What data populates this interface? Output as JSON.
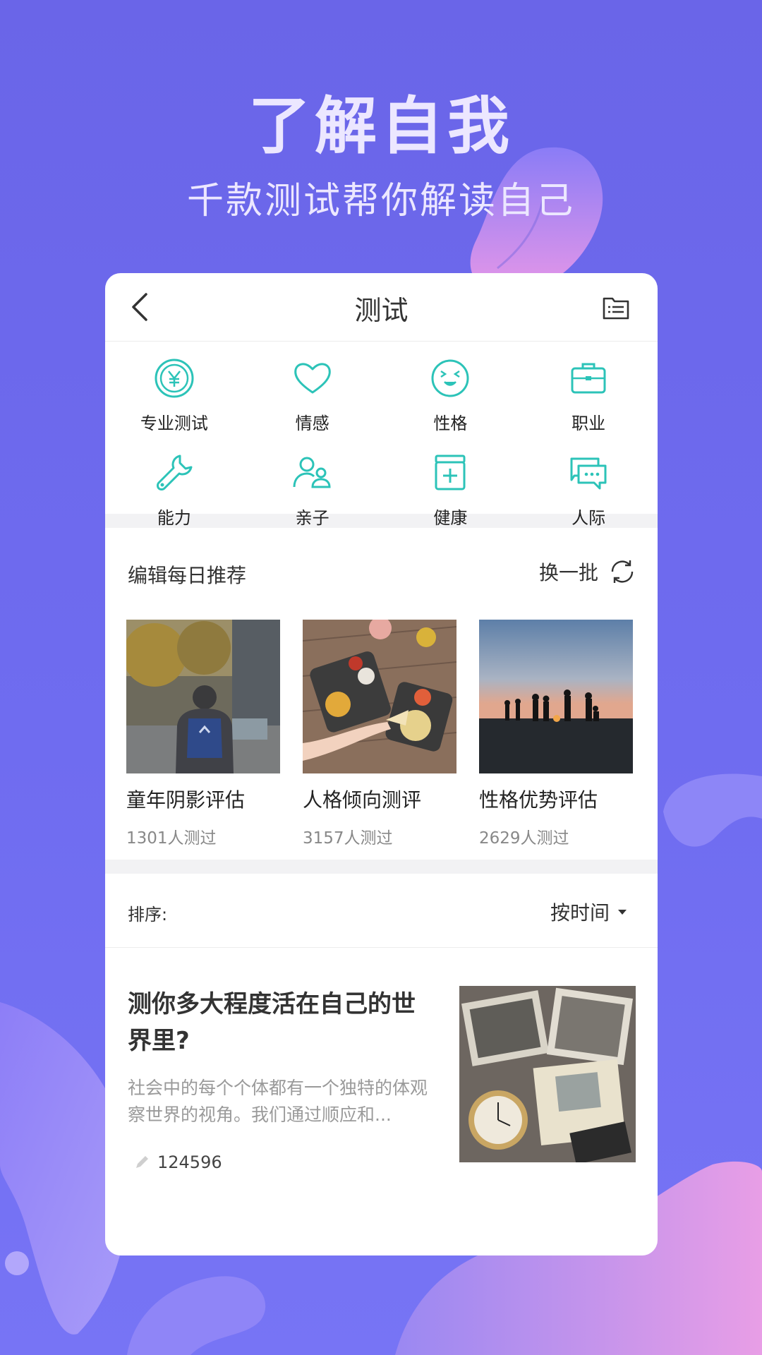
{
  "hero": {
    "title": "了解自我",
    "subtitle": "千款测试帮你解读自己"
  },
  "nav": {
    "title": "测试",
    "back_icon": "chevron-left-icon",
    "right_icon": "list-icon"
  },
  "accent_color": "#2cc3b8",
  "categories": [
    {
      "label": "专业测试",
      "icon": "yen-coin-icon"
    },
    {
      "label": "情感",
      "icon": "heart-icon"
    },
    {
      "label": "性格",
      "icon": "smiley-icon"
    },
    {
      "label": "职业",
      "icon": "briefcase-icon"
    },
    {
      "label": "能力",
      "icon": "wrench-icon"
    },
    {
      "label": "亲子",
      "icon": "parent-child-icon"
    },
    {
      "label": "健康",
      "icon": "medicine-box-icon"
    },
    {
      "label": "人际",
      "icon": "chat-bubbles-icon"
    }
  ],
  "recommend": {
    "title": "编辑每日推荐",
    "swap_label": "换一批",
    "items": [
      {
        "name": "童年阴影评估",
        "count": "1301人测过"
      },
      {
        "name": "人格倾向测评",
        "count": "3157人测过"
      },
      {
        "name": "性格优势评估",
        "count": "2629人测过"
      }
    ]
  },
  "sort": {
    "label": "排序:",
    "value": "按时间"
  },
  "article": {
    "title": "测你多大程度活在自己的世界里?",
    "desc": "社会中的每个个体都有一个独特的体观察世界的视角。我们通过顺应和...",
    "views": "124596"
  }
}
